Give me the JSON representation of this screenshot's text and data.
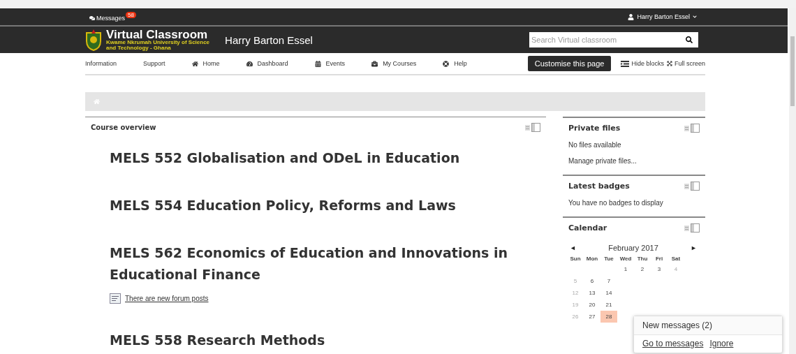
{
  "top_bar": {
    "messages": {
      "label": "Messages",
      "count": "58"
    },
    "user": "Harry Barton Essel"
  },
  "header": {
    "site_title": "Virtual Classroom",
    "site_subtitle_lines": [
      "Kwame Nkrumah University of Science",
      "and Technology - Ghana"
    ],
    "page_user": "Harry Barton Essel",
    "search": {
      "placeholder": "Search Virtual classroom"
    }
  },
  "nav": {
    "items": [
      {
        "label": "Information"
      },
      {
        "label": "Support"
      },
      {
        "label": "Home"
      },
      {
        "label": "Dashboard"
      },
      {
        "label": "Events"
      },
      {
        "label": "My Courses"
      },
      {
        "label": "Help"
      }
    ],
    "customise_button": "Customise this page",
    "hide_blocks": "Hide blocks",
    "full_screen": "Full screen"
  },
  "course_overview": {
    "title": "Course overview",
    "courses": [
      {
        "name": "MELS 552 Globalisation and ODeL in Education"
      },
      {
        "name": "MELS 554 Education Policy, Reforms and Laws"
      },
      {
        "name": "MELS 562 Economics of Education and Innovations in Educational Finance",
        "notice": "There are new forum posts"
      },
      {
        "name": "MELS 558 Research Methods"
      }
    ]
  },
  "private_files": {
    "title": "Private files",
    "lines": [
      "No files available"
    ],
    "link": "Manage private files..."
  },
  "latest_badges": {
    "title": "Latest badges",
    "lines": [
      "You have no badges to display"
    ]
  },
  "calendar": {
    "title": "Calendar",
    "prev": "◄",
    "next": "►",
    "month": "February 2017",
    "weekdays": [
      "Sun",
      "Mon",
      "Tue",
      "Wed",
      "Thu",
      "Fri",
      "Sat"
    ],
    "weeks": [
      [
        {
          "kind": "blank"
        },
        {
          "kind": "blank"
        },
        {
          "kind": "blank"
        },
        {
          "kind": "day",
          "day": "1",
          "weekend": false,
          "today": false
        },
        {
          "kind": "day",
          "day": "2",
          "weekend": false,
          "today": false
        },
        {
          "kind": "day",
          "day": "3",
          "weekend": false,
          "today": false
        },
        {
          "kind": "day",
          "day": "4",
          "weekend": true,
          "today": false
        }
      ],
      [
        {
          "kind": "day",
          "day": "5",
          "weekend": true,
          "today": false
        },
        {
          "kind": "day",
          "day": "6",
          "weekend": false,
          "today": false
        },
        {
          "kind": "day",
          "day": "7",
          "weekend": false,
          "today": false
        }
      ],
      [
        {
          "kind": "day",
          "day": "12",
          "weekend": true,
          "today": false
        },
        {
          "kind": "day",
          "day": "13",
          "weekend": false,
          "today": false
        },
        {
          "kind": "day",
          "day": "14",
          "weekend": false,
          "today": false
        }
      ],
      [
        {
          "kind": "day",
          "day": "19",
          "weekend": true,
          "today": false
        },
        {
          "kind": "day",
          "day": "20",
          "weekend": false,
          "today": false
        },
        {
          "kind": "day",
          "day": "21",
          "weekend": false,
          "today": false
        }
      ],
      [
        {
          "kind": "day",
          "day": "26",
          "weekend": true,
          "today": false
        },
        {
          "kind": "day",
          "day": "27",
          "weekend": false,
          "today": false
        },
        {
          "kind": "day",
          "day": "28",
          "weekend": false,
          "today": true
        }
      ]
    ]
  },
  "popup": {
    "title": "New messages (2)",
    "go_link": "Go to messages",
    "ignore_link": "Ignore"
  }
}
